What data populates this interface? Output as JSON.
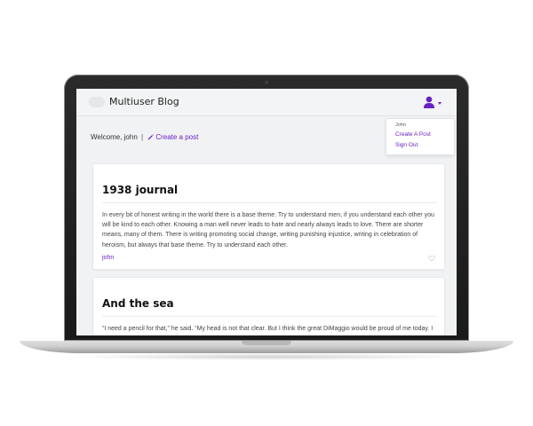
{
  "app": {
    "brand": "Multiuser Blog",
    "accent_color": "#6a1fc7"
  },
  "user_menu": {
    "icon": "user-icon",
    "username": "John",
    "items": [
      {
        "label": "Create A Post"
      },
      {
        "label": "Sign Out"
      }
    ]
  },
  "welcome": {
    "text": "Welcome, john",
    "separator": "|",
    "create_post_label": "Create a post",
    "create_post_icon": "pencil-icon"
  },
  "posts": [
    {
      "title": "1938 journal",
      "body": "In every bit of honest writing in the world there is a base theme. Try to understand men, if you understand each other you will be kind to each other. Knowing a man well never leads to hate and nearly always leads to love. There are shorter means, many of them. There is writing promoting social change, writing punishing injustice, writing in celebration of heroism, but always that base theme. Try to understand each other.",
      "author": "john",
      "like_icon": "heart-icon"
    },
    {
      "title": "And the sea",
      "body": "“I need a pencil for that,” he said. “My head is not that clear. But I think the great DiMaggio would be proud of me today. I had no"
    }
  ]
}
